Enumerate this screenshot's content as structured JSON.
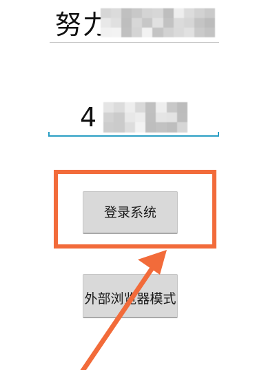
{
  "form": {
    "username_value": "努力",
    "password_value": "4"
  },
  "buttons": {
    "login_label": "登录系统",
    "browser_mode_label": "外部浏览器模式"
  },
  "colors": {
    "accent_underline": "#2a9ec4",
    "annotation": "#f26b3a",
    "button_bg": "#d9d9d9"
  }
}
